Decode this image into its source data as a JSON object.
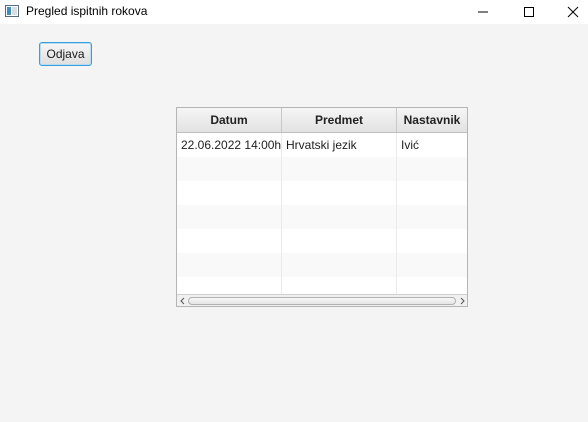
{
  "window": {
    "title": "Pregled ispitnih rokova",
    "icon": "java-app-icon",
    "controls": [
      "minimize-icon",
      "maximize-icon",
      "close-icon"
    ]
  },
  "toolbar": {
    "logout_label": "Odjava"
  },
  "table": {
    "columns": [
      "Datum",
      "Predmet",
      "Nastavnik"
    ],
    "rows": [
      [
        "22.06.2022 14:00h",
        "Hrvatski jezik",
        "Ivić"
      ]
    ]
  },
  "colors": {
    "focus_border": "#3c9ed8",
    "background": "#f4f4f4"
  }
}
